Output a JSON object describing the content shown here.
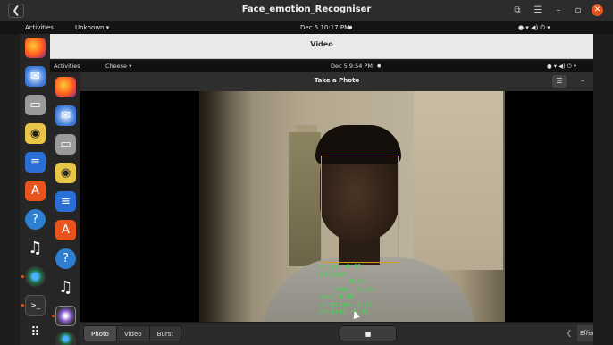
{
  "outer": {
    "window_title": "Face_emotion_Recogniser",
    "back_glyph": "❮",
    "controls": {
      "restore": "⧉",
      "menu": "☰",
      "minimize": "–",
      "close": "✕"
    },
    "topbar": {
      "activities": "Activities",
      "app_menu": "Unknown ▾",
      "clock": "Dec 5  10:17 PM",
      "clock_dot": "●",
      "status_icons": "●  ▾  ◀)  ⏻ ▾"
    },
    "dock": [
      "firefox-icon",
      "thunderbird-icon",
      "files-icon",
      "rhythmbox-icon",
      "writer-icon",
      "software-icon",
      "help-icon",
      "music-icon",
      "chromium-icon",
      "terminal-icon",
      "apps-grid-icon"
    ]
  },
  "video_window": {
    "title": "Video"
  },
  "inner": {
    "topbar": {
      "activities": "Activities",
      "app_menu": "Cheese ▾",
      "clock": "Dec 5  9:54 PM",
      "clock_dot": "●",
      "status_icons": "●  ▾  ◀)  ⏻ ▾"
    },
    "window_title": "Take a Photo",
    "menu_glyph": "☰",
    "minimize_glyph": "–",
    "emotions_text": "angry: 0.15\ndisgust:\n        0.08\n    fear: 0.20\nsad: 0.20\nsurprise: 0.17\nneutral: 0.16",
    "bottom": {
      "tabs": [
        "Photo",
        "Video",
        "Burst"
      ],
      "active_tab": "Photo",
      "capture_glyph": "■",
      "prev_glyph": "❮",
      "effects_label": "Effects"
    }
  },
  "colors": {
    "face_box": "#d99a22",
    "emotion_text": "#33e04a",
    "close": "#e9541e"
  }
}
